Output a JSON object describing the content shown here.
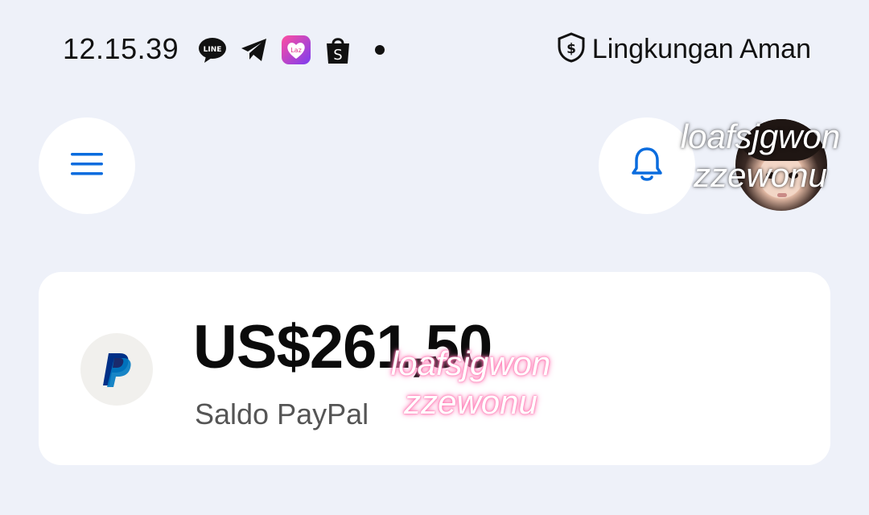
{
  "status_bar": {
    "time": "12.15.39",
    "line_icon_text": "LINE",
    "lazada_icon_text": "Laz",
    "security_text": "Lingkungan Aman"
  },
  "header": {
    "menu_icon": "hamburger-menu-icon",
    "notification_icon": "bell-icon"
  },
  "watermark": {
    "top": [
      "loafsjgwon",
      "zzewonu"
    ],
    "middle": [
      "loafsjgwon",
      "zzewonu"
    ]
  },
  "balance": {
    "amount": "US$261,50",
    "label": "Saldo PayPal"
  },
  "colors": {
    "background": "#eef1f9",
    "accent_blue": "#0a6cde",
    "paypal_dark": "#003087",
    "paypal_light": "#0079c1"
  }
}
